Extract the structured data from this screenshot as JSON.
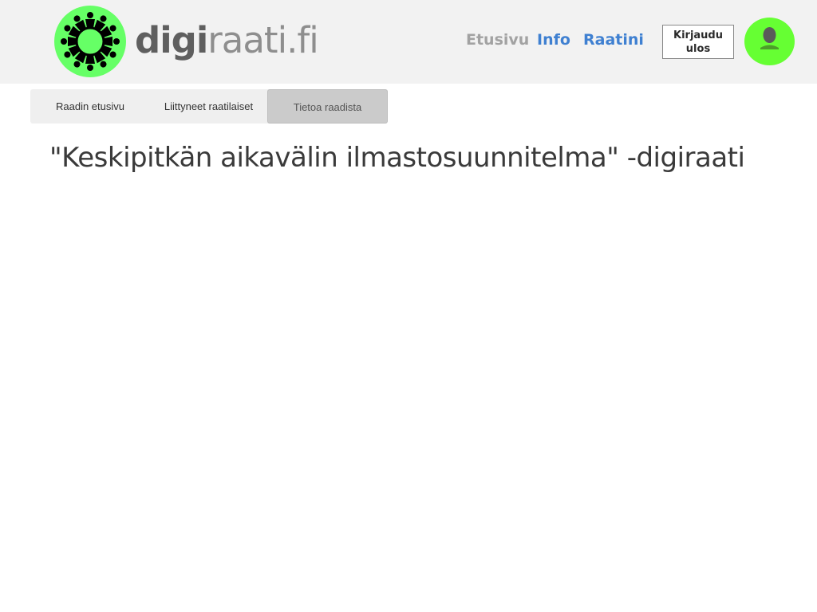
{
  "header": {
    "logo": {
      "bold_text": "digi",
      "light_text": "raati.fi",
      "icon": "people-circle-logo-icon",
      "colors": {
        "circle": "#66ff66",
        "figures": "#000000"
      }
    },
    "nav": [
      {
        "label": "Etusivu",
        "active": true
      },
      {
        "label": "Info",
        "active": false
      },
      {
        "label": "Raatini",
        "active": false
      }
    ],
    "logout_label": "Kirjaudu ulos",
    "avatar_icon": "user-avatar-icon"
  },
  "tabs": [
    {
      "label": "Raadin etusivu",
      "selected": false
    },
    {
      "label": "Liittyneet raatilaiset",
      "selected": false
    },
    {
      "label": "Tietoa raadista",
      "selected": true
    }
  ],
  "page": {
    "title": "\"Keskipitkän aikavälin ilmastosuunnitelma\" -digiraati"
  },
  "colors": {
    "header_bg": "#f2f2f2",
    "link_blue": "#3f80d1",
    "nav_inactive_gray": "#a2a2a2",
    "avatar_green": "#66ff33",
    "tab_selected_bg": "#cbcbcb"
  }
}
